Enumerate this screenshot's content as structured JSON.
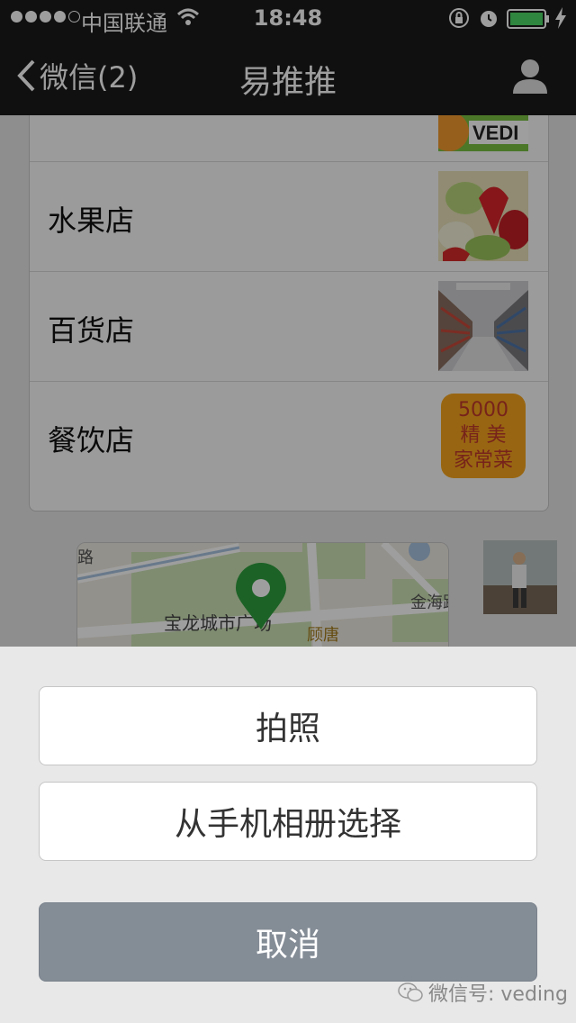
{
  "status_bar": {
    "carrier": "中国联通",
    "time": "18:48"
  },
  "nav": {
    "back_label": "微信(2)",
    "title": "易推推"
  },
  "list": {
    "items": [
      {
        "label": "",
        "thumb_text": "VEDI"
      },
      {
        "label": "水果店"
      },
      {
        "label": "百货店"
      },
      {
        "label": "餐饮店",
        "thumb_lines": [
          "5000",
          "精 美",
          "家常菜"
        ]
      }
    ]
  },
  "map": {
    "road_1": "路",
    "road_2": "金海路",
    "place": "宝龙城市广场",
    "road_3": "顾唐"
  },
  "action_sheet": {
    "take_photo": "拍照",
    "choose_from_album": "从手机相册选择",
    "cancel": "取消"
  },
  "watermark": "微信号: veding",
  "colors": {
    "bar": "#1b1b1b",
    "battery": "#4cd964",
    "cancel": "#848c96",
    "pin": "#2e9e3e"
  }
}
